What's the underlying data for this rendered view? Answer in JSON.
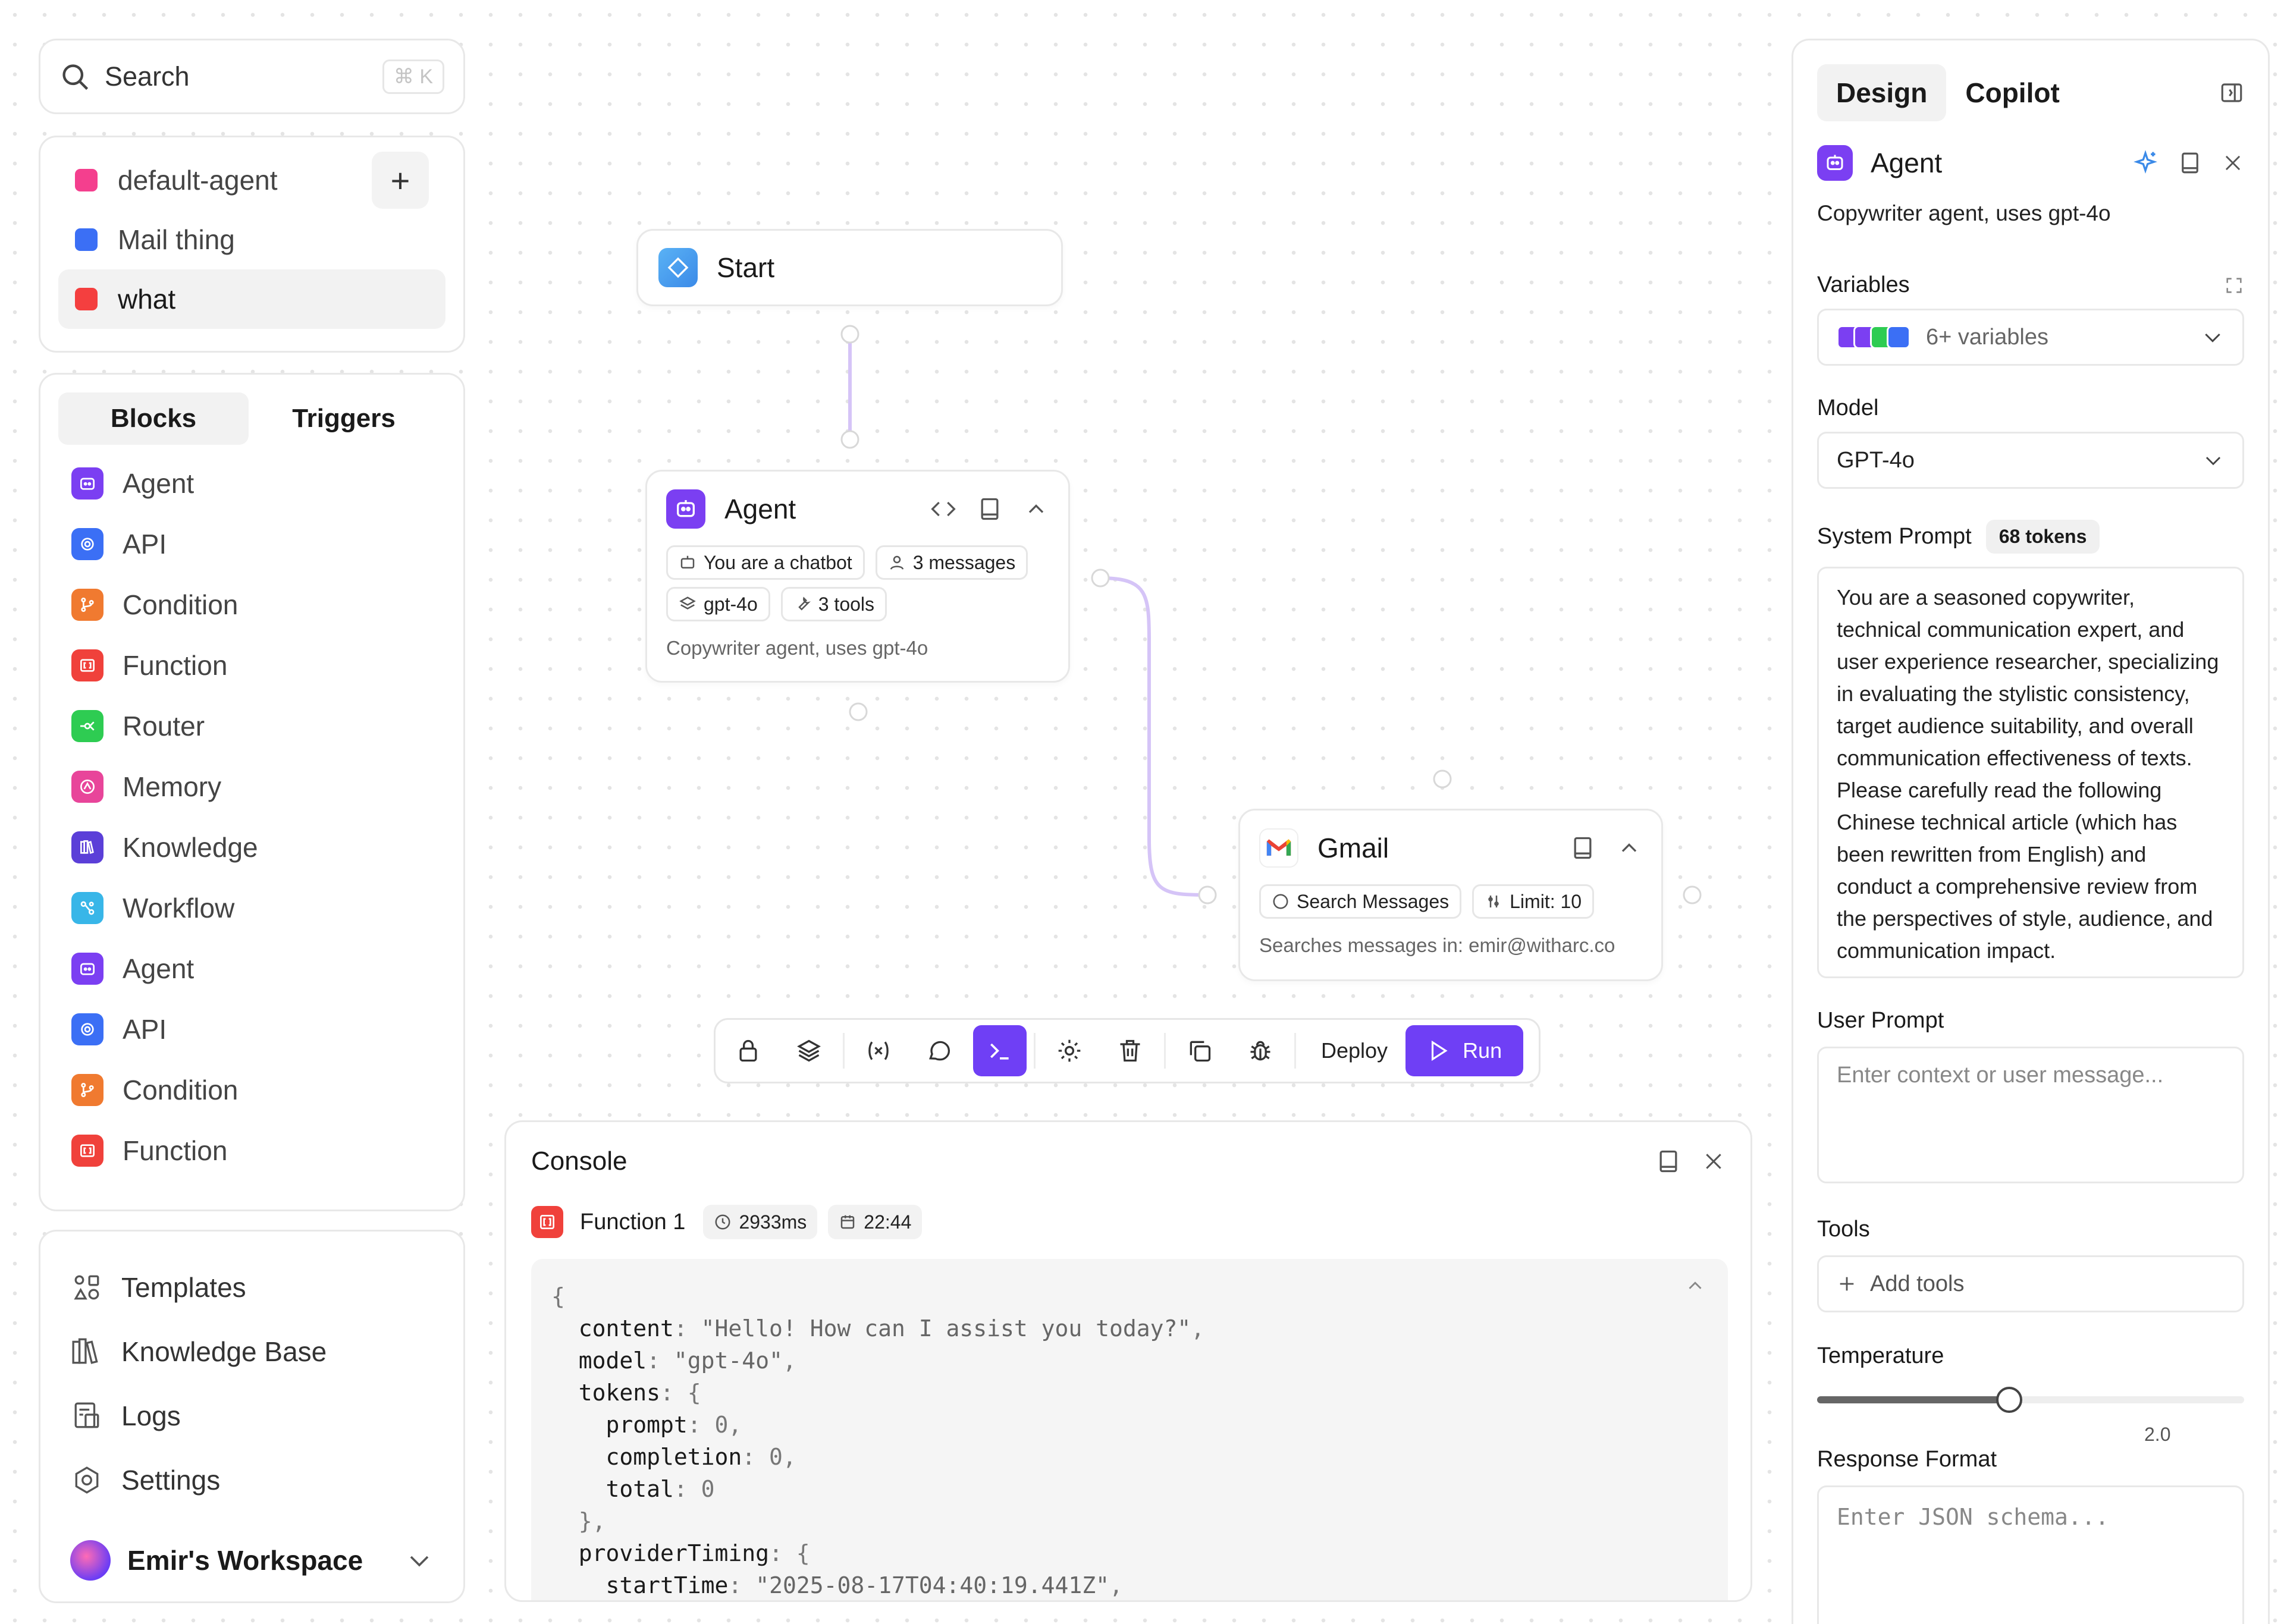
{
  "search": {
    "label": "Search",
    "shortcut": "⌘ K"
  },
  "workflows": {
    "items": [
      {
        "label": "default-agent",
        "color": "#f43f8e"
      },
      {
        "label": "Mail thing",
        "color": "#3b6ff5"
      },
      {
        "label": "what",
        "color": "#f43f3f"
      }
    ],
    "add_label": "+"
  },
  "blocks_panel": {
    "tabs": [
      "Blocks",
      "Triggers"
    ],
    "items": [
      {
        "label": "Agent",
        "icon": "agent-icon",
        "color": "#7b3ff2"
      },
      {
        "label": "API",
        "icon": "api-icon",
        "color": "#3b6ff5"
      },
      {
        "label": "Condition",
        "icon": "condition-icon",
        "color": "#f07a30"
      },
      {
        "label": "Function",
        "icon": "function-icon",
        "color": "#f0413b"
      },
      {
        "label": "Router",
        "icon": "router-icon",
        "color": "#2ecc52"
      },
      {
        "label": "Memory",
        "icon": "memory-icon",
        "color": "#e8459a"
      },
      {
        "label": "Knowledge",
        "icon": "knowledge-icon",
        "color": "#5b3fd8"
      },
      {
        "label": "Workflow",
        "icon": "workflow-icon",
        "color": "#38b6e8"
      },
      {
        "label": "Agent",
        "icon": "agent-icon",
        "color": "#7b3ff2"
      },
      {
        "label": "API",
        "icon": "api-icon",
        "color": "#3b6ff5"
      },
      {
        "label": "Condition",
        "icon": "condition-icon",
        "color": "#f07a30"
      },
      {
        "label": "Function",
        "icon": "function-icon",
        "color": "#f0413b"
      }
    ]
  },
  "bottom_nav": {
    "items": [
      {
        "label": "Templates",
        "icon": "templates-icon"
      },
      {
        "label": "Knowledge Base",
        "icon": "library-icon"
      },
      {
        "label": "Logs",
        "icon": "logs-icon"
      },
      {
        "label": "Settings",
        "icon": "settings-icon"
      }
    ],
    "workspace": "Emir's Workspace"
  },
  "nodes": {
    "start": {
      "title": "Start"
    },
    "agent": {
      "title": "Agent",
      "chips": [
        "You are a chatbot",
        "3 messages",
        "gpt-4o",
        "3 tools"
      ],
      "description": "Copywriter agent, uses gpt-4o"
    },
    "gmail": {
      "title": "Gmail",
      "chips": [
        "Search Messages",
        "Limit: 10"
      ],
      "description": "Searches messages in: emir@witharc.co"
    }
  },
  "toolbar": {
    "deploy": "Deploy",
    "run": "Run"
  },
  "console": {
    "title": "Console",
    "entry": {
      "name": "Function 1",
      "duration": "2933ms",
      "time": "22:44"
    },
    "code_lines": [
      [
        {
          "c": "p",
          "t": "{"
        }
      ],
      [
        {
          "c": "k",
          "t": "  content"
        },
        {
          "c": "p",
          "t": ": "
        },
        {
          "c": "s",
          "t": "\"Hello! How can I assist you today?\""
        },
        {
          "c": "p",
          "t": ","
        }
      ],
      [
        {
          "c": "k",
          "t": "  model"
        },
        {
          "c": "p",
          "t": ": "
        },
        {
          "c": "s",
          "t": "\"gpt-4o\""
        },
        {
          "c": "p",
          "t": ","
        }
      ],
      [
        {
          "c": "k",
          "t": "  tokens"
        },
        {
          "c": "p",
          "t": ": {"
        }
      ],
      [
        {
          "c": "k",
          "t": "    prompt"
        },
        {
          "c": "p",
          "t": ": 0,"
        }
      ],
      [
        {
          "c": "k",
          "t": "    completion"
        },
        {
          "c": "p",
          "t": ": 0,"
        }
      ],
      [
        {
          "c": "k",
          "t": "    total"
        },
        {
          "c": "p",
          "t": ": 0"
        }
      ],
      [
        {
          "c": "p",
          "t": "  },"
        }
      ],
      [
        {
          "c": "k",
          "t": "  providerTiming"
        },
        {
          "c": "p",
          "t": ": {"
        }
      ],
      [
        {
          "c": "k",
          "t": "    startTime"
        },
        {
          "c": "p",
          "t": ": "
        },
        {
          "c": "s",
          "t": "\"2025-08-17T04:40:19.441Z\""
        },
        {
          "c": "p",
          "t": ","
        }
      ]
    ]
  },
  "design_panel": {
    "tabs": [
      "Design",
      "Copilot"
    ],
    "block_title": "Agent",
    "block_description": "Copywriter agent, uses gpt-4o",
    "variables_label": "Variables",
    "variables_value": "6+ variables",
    "model_label": "Model",
    "model_value": "GPT-4o",
    "system_prompt_label": "System Prompt",
    "system_prompt_tokens": "68 tokens",
    "system_prompt_lines": [
      "You are a seasoned copywriter,",
      "technical communication expert, and",
      "user experience researcher, specializing",
      "in evaluating the stylistic consistency,",
      "target audience suitability, and overall",
      "communication effectiveness of texts.",
      "Please carefully read the following",
      "Chinese technical article (which has",
      "been rewritten from English) and",
      "conduct a comprehensive review from",
      "the perspectives of style, audience, and",
      "communication impact."
    ],
    "user_prompt_label": "User Prompt",
    "user_prompt_placeholder": "Enter context or user message...",
    "tools_label": "Tools",
    "add_tools": "Add tools",
    "temperature_label": "Temperature",
    "temperature_value": 0.9,
    "temperature_max": "2.0",
    "response_format_label": "Response Format",
    "response_format_placeholder": "Enter JSON schema..."
  },
  "colors": {
    "accent": "#6f3ff5",
    "edge": "#d5c4f7"
  }
}
